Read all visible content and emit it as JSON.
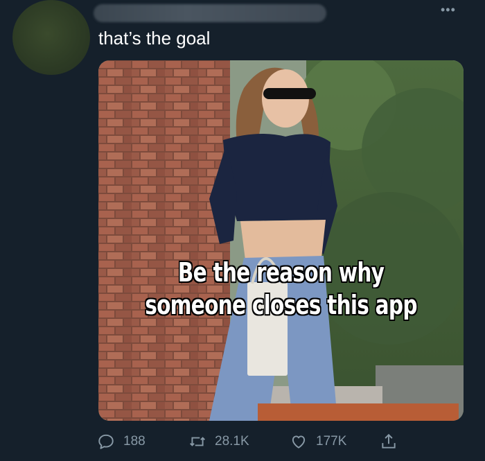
{
  "tweet": {
    "author_name_hidden": true,
    "text": "that’s the goal",
    "more_icon": "more-horizontal-icon",
    "media": {
      "caption_line1": "Be the reason why",
      "caption_line2": "someone closes this app"
    }
  },
  "actions": {
    "reply": {
      "icon": "reply-icon",
      "count": "188"
    },
    "retweet": {
      "icon": "retweet-icon",
      "count": "28.1K"
    },
    "like": {
      "icon": "heart-icon",
      "count": "177K"
    },
    "share": {
      "icon": "share-icon"
    }
  },
  "colors": {
    "background": "#15202b",
    "text": "#ffffff",
    "secondary": "#8899a6"
  }
}
